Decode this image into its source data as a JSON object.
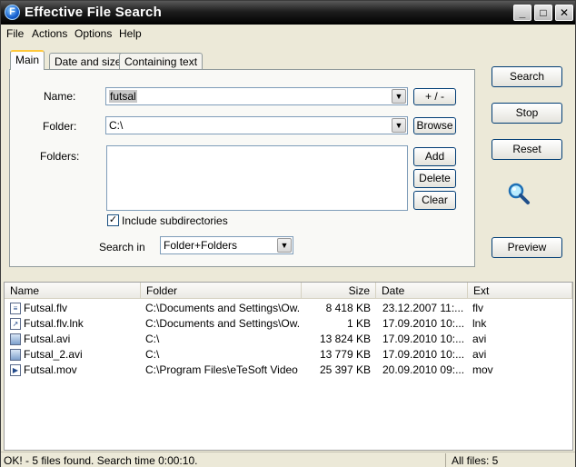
{
  "window": {
    "title": "Effective File Search",
    "icon_letter": "F",
    "controls": {
      "minimize": "_",
      "maximize": "□",
      "close": "✕"
    }
  },
  "menu": [
    "File",
    "Actions",
    "Options",
    "Help"
  ],
  "tabs": [
    "Main",
    "Date and size",
    "Containing text"
  ],
  "form": {
    "name_label": "Name:",
    "name_value": "futsal",
    "plus_minus_label": "+ / -",
    "folder_label": "Folder:",
    "folder_value": "C:\\",
    "browse_label": "Browse",
    "folders_label": "Folders:",
    "add_label": "Add",
    "delete_label": "Delete",
    "clear_label": "Clear",
    "include_subdirs_label": "Include subdirectories",
    "include_subdirs_checked": true,
    "search_in_label": "Search in",
    "search_in_value": "Folder+Folders"
  },
  "side_buttons": {
    "search": "Search",
    "stop": "Stop",
    "reset": "Reset",
    "preview": "Preview"
  },
  "columns": [
    "Name",
    "Folder",
    "Size",
    "Date",
    "Ext"
  ],
  "rows": [
    {
      "icon": "document-icon",
      "name": "Futsal.flv",
      "folder": "C:\\Documents and Settings\\Ow...",
      "size": "8 418 KB",
      "date": "23.12.2007 11:...",
      "ext": "flv"
    },
    {
      "icon": "shortcut-icon",
      "name": "Futsal.flv.lnk",
      "folder": "C:\\Documents and Settings\\Ow...",
      "size": "1 KB",
      "date": "17.09.2010 10:...",
      "ext": "lnk"
    },
    {
      "icon": "video-file-icon",
      "name": "Futsal.avi",
      "folder": "C:\\",
      "size": "13 824 KB",
      "date": "17.09.2010 10:...",
      "ext": "avi"
    },
    {
      "icon": "video-file-icon",
      "name": "Futsal_2.avi",
      "folder": "C:\\",
      "size": "13 779 KB",
      "date": "17.09.2010 10:...",
      "ext": "avi"
    },
    {
      "icon": "movie-file-icon",
      "name": "Futsal.mov",
      "folder": "C:\\Program Files\\eTeSoft Video ...",
      "size": "25 397 KB",
      "date": "20.09.2010 09:...",
      "ext": "mov"
    }
  ],
  "status": {
    "message": "OK! - 5 files found. Search time 0:00:10.",
    "count": "All files: 5"
  },
  "colors": {
    "titlebar": "#1e1e1e",
    "tab_highlight": "#ffc83c",
    "button_border": "#003c74",
    "selection": "#c8c8c8"
  }
}
